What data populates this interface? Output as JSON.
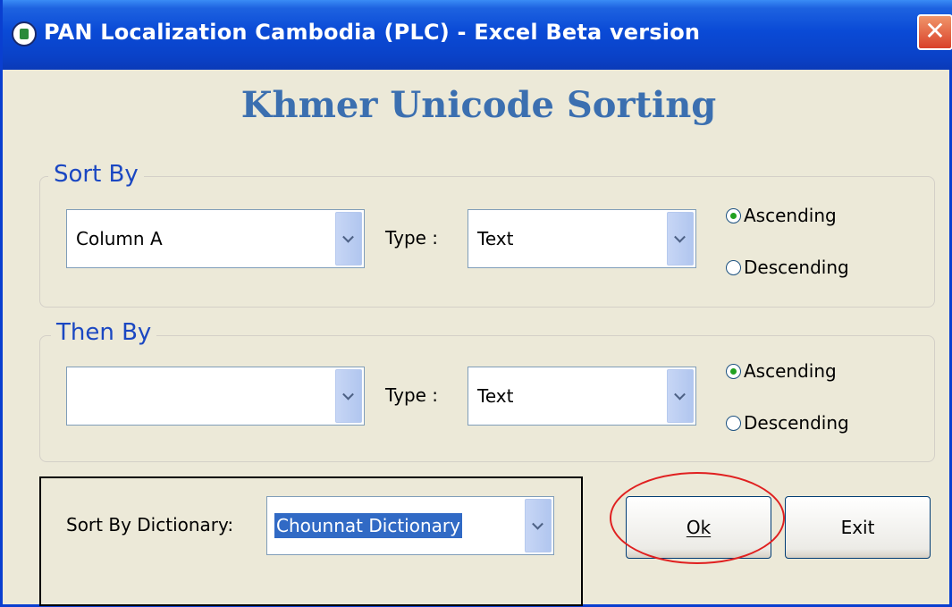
{
  "window": {
    "title": "PAN Localization Cambodia (PLC) - Excel Beta version",
    "close_label": "✕"
  },
  "heading": "Khmer Unicode Sorting",
  "sort_by": {
    "group_label": "Sort By",
    "column_value": "Column A",
    "type_label": "Type :",
    "type_value": "Text",
    "ascending_label": "Ascending",
    "descending_label": "Descending",
    "order": "ascending"
  },
  "then_by": {
    "group_label": "Then By",
    "column_value": "",
    "type_label": "Type :",
    "type_value": "Text",
    "ascending_label": "Ascending",
    "descending_label": "Descending",
    "order": "ascending"
  },
  "dictionary": {
    "label": "Sort By Dictionary:",
    "value": "Chounnat Dictionary"
  },
  "buttons": {
    "ok_label": "Ok",
    "exit_label": "Exit"
  },
  "colors": {
    "title_bar": "#0a4ad6",
    "heading": "#3b6fb0",
    "group_label": "#1a47c2",
    "selection": "#316ac5",
    "annotation_circle": "#e02020"
  }
}
